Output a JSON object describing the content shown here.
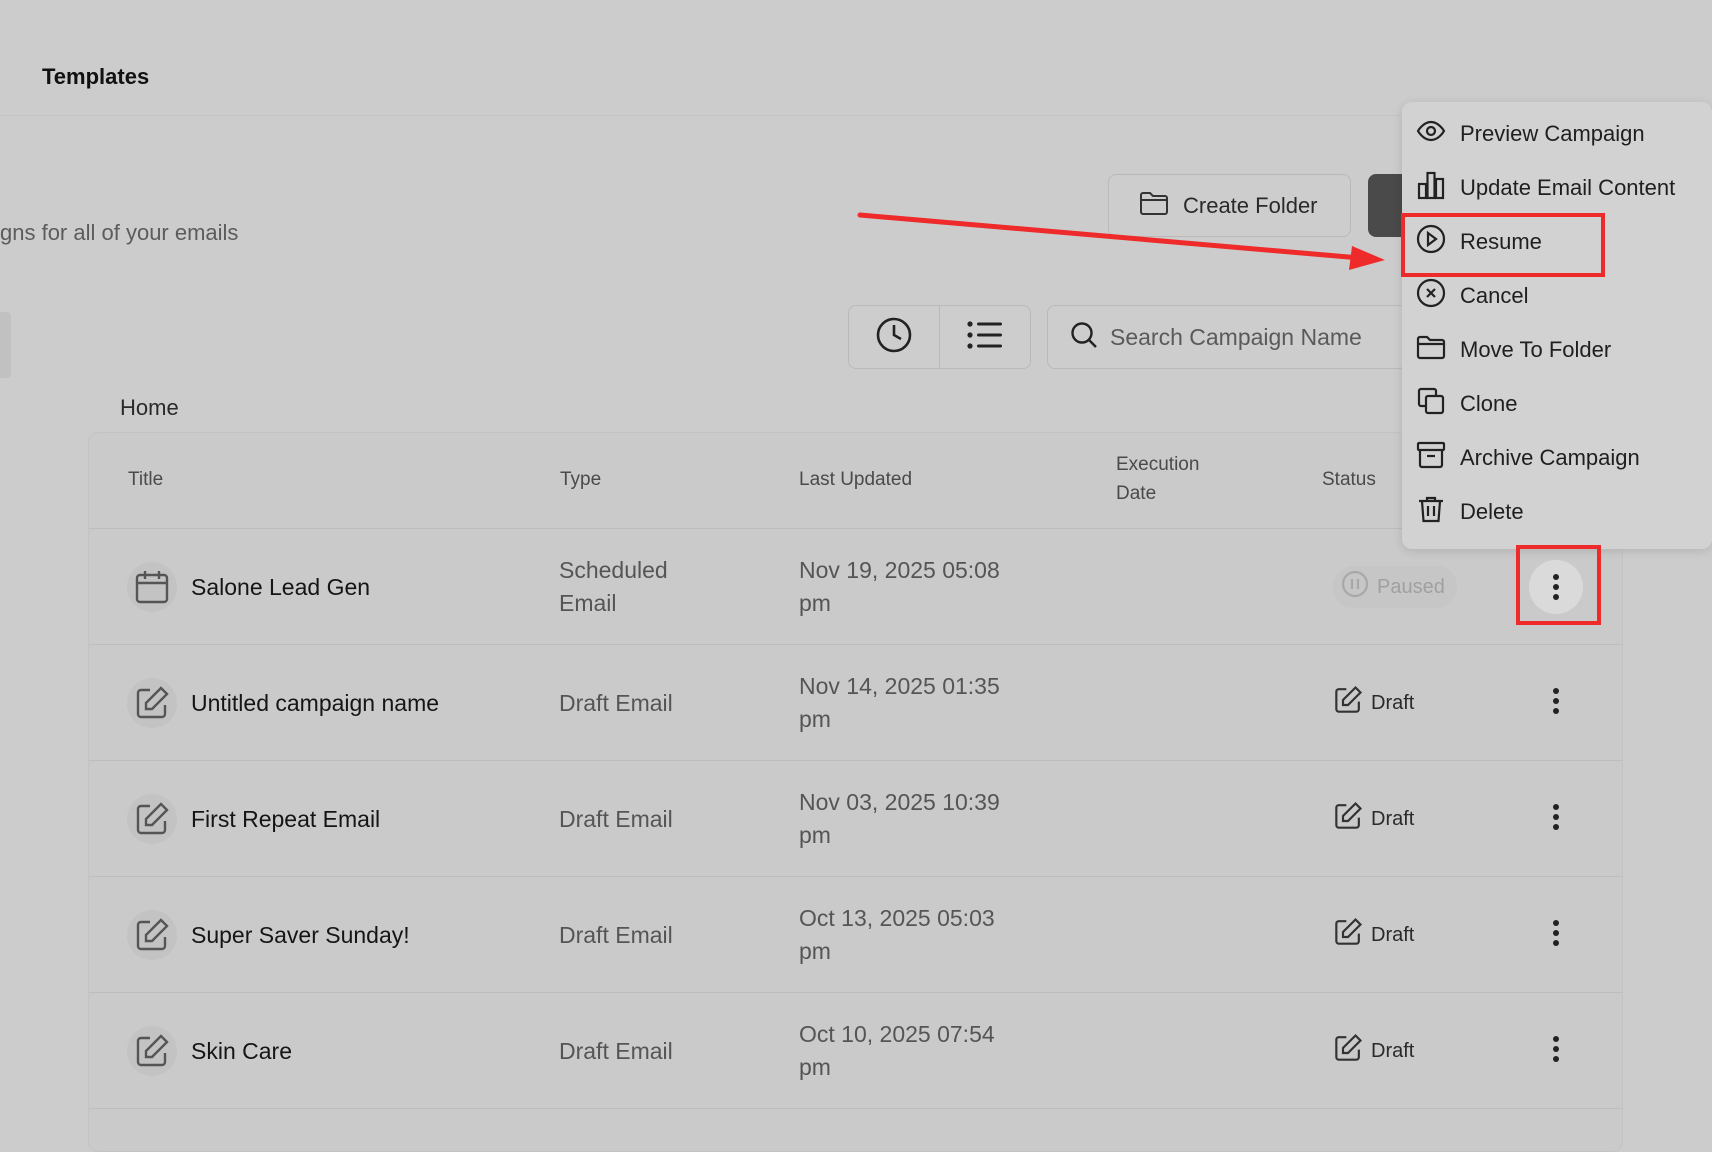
{
  "header": {
    "tab_label": "Templates"
  },
  "page": {
    "subtitle": "gns for all of your emails"
  },
  "toolbar": {
    "create_folder_label": "Create Folder",
    "search_placeholder": "Search Campaign Name"
  },
  "breadcrumb": {
    "current": "Home"
  },
  "table": {
    "columns": {
      "title": "Title",
      "type": "Type",
      "last_updated": "Last Updated",
      "execution_date_line1": "Execution",
      "execution_date_line2": "Date",
      "status": "Status"
    },
    "rows": [
      {
        "title": "Salone Lead Gen",
        "type_line1": "Scheduled",
        "type_line2": "Email",
        "updated_line1": "Nov 19, 2025 05:08",
        "updated_line2": "pm",
        "status": "Paused",
        "icon": "calendar-icon"
      },
      {
        "title": "Untitled campaign name",
        "type_line1": "Draft Email",
        "type_line2": "",
        "updated_line1": "Nov 14, 2025 01:35",
        "updated_line2": "pm",
        "status": "Draft",
        "icon": "edit-icon"
      },
      {
        "title": "First Repeat Email",
        "type_line1": "Draft Email",
        "type_line2": "",
        "updated_line1": "Nov 03, 2025 10:39",
        "updated_line2": "pm",
        "status": "Draft",
        "icon": "edit-icon"
      },
      {
        "title": "Super Saver Sunday!",
        "type_line1": "Draft Email",
        "type_line2": "",
        "updated_line1": "Oct 13, 2025 05:03",
        "updated_line2": "pm",
        "status": "Draft",
        "icon": "edit-icon"
      },
      {
        "title": "Skin Care",
        "type_line1": "Draft Email",
        "type_line2": "",
        "updated_line1": "Oct 10, 2025 07:54",
        "updated_line2": "pm",
        "status": "Draft",
        "icon": "edit-icon"
      }
    ]
  },
  "menu": {
    "items": [
      {
        "label": "Preview Campaign",
        "icon": "eye-icon"
      },
      {
        "label": "Update Email Content",
        "icon": "bar-chart-icon"
      },
      {
        "label": "Resume",
        "icon": "play-circle-icon"
      },
      {
        "label": "Cancel",
        "icon": "x-circle-icon"
      },
      {
        "label": "Move To Folder",
        "icon": "folder-icon"
      },
      {
        "label": "Clone",
        "icon": "copy-icon"
      },
      {
        "label": "Archive Campaign",
        "icon": "archive-icon"
      },
      {
        "label": "Delete",
        "icon": "trash-icon"
      }
    ]
  },
  "colors": {
    "highlight": "#ee2a2a",
    "background": "#cccccc"
  }
}
